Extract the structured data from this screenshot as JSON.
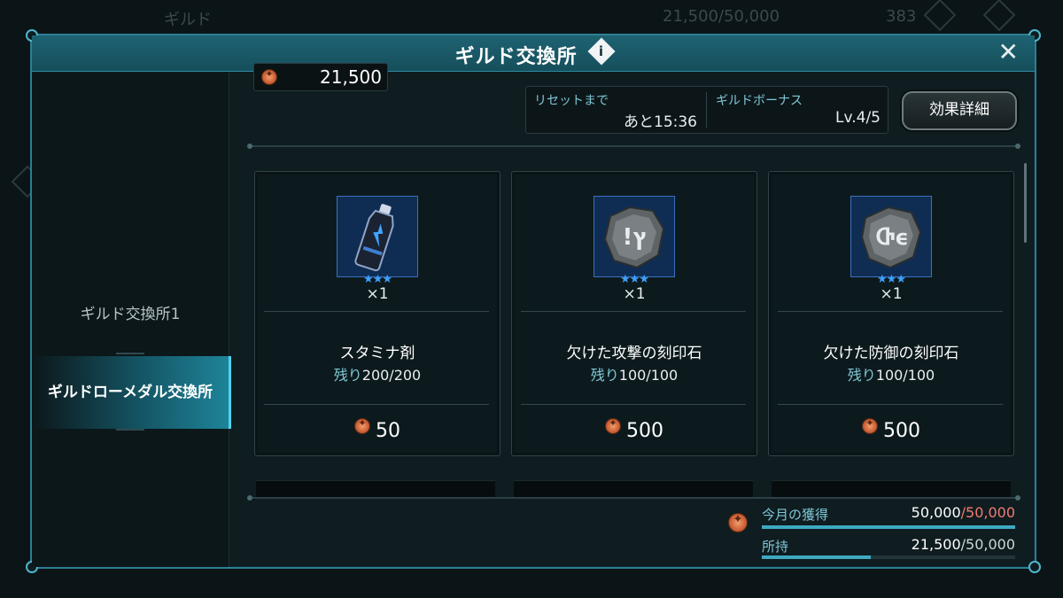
{
  "background": {
    "hud_guild_label": "ギルド",
    "hud_currency": "21,500/50,000",
    "hud_count": "383"
  },
  "modal": {
    "title": "ギルド交換所",
    "info_icon": "i"
  },
  "sidebar": {
    "tabs": [
      {
        "label": "ギルド交換所1",
        "active": false
      },
      {
        "label": "ギルドローメダル交換所",
        "active": true
      }
    ]
  },
  "top": {
    "currency_value": "21,500",
    "reset_label": "リセットまで",
    "reset_value": "あと15:36",
    "bonus_label": "ギルドボーナス",
    "bonus_value": "Lv.4/5",
    "effect_button": "効果詳細"
  },
  "items": [
    {
      "icon": "stamina-potion-icon",
      "stars": "★★★",
      "qty": "×1",
      "name": "スタミナ剤",
      "remain_label": "残り",
      "remain_value": "200/200",
      "price": "50"
    },
    {
      "icon": "attack-rune-stone-icon",
      "stars": "★★★",
      "qty": "×1",
      "name": "欠けた攻撃の刻印石",
      "remain_label": "残り",
      "remain_value": "100/100",
      "price": "500"
    },
    {
      "icon": "defense-rune-stone-icon",
      "stars": "★★★",
      "qty": "×1",
      "name": "欠けた防御の刻印石",
      "remain_label": "残り",
      "remain_value": "100/100",
      "price": "500"
    }
  ],
  "stats": {
    "monthly_label": "今月の獲得",
    "monthly_value": "50,000",
    "monthly_max": "/50,000",
    "monthly_progress": 1.0,
    "owned_label": "所持",
    "owned_value": "21,500",
    "owned_max": "/50,000",
    "owned_progress": 0.43
  },
  "colors": {
    "accent": "#2d7f92",
    "header": "#1e6272",
    "limit_red": "#f07c72",
    "star_blue": "#3da2ff"
  }
}
